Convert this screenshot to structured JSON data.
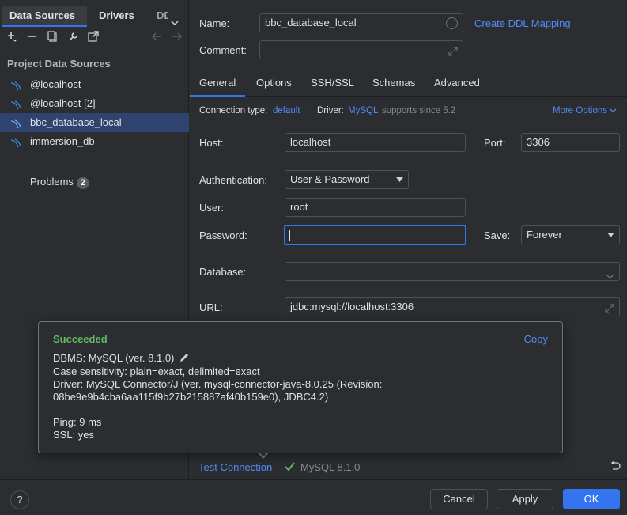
{
  "left": {
    "tabs": [
      "Data Sources",
      "Drivers",
      "DDL"
    ],
    "section_title": "Project Data Sources",
    "items": [
      {
        "label": "@localhost"
      },
      {
        "label": "@localhost [2]"
      },
      {
        "label": "bbc_database_local"
      },
      {
        "label": "immersion_db"
      }
    ],
    "problems_label": "Problems",
    "problems_count": "2"
  },
  "right": {
    "name_label": "Name:",
    "name_value": "bbc_database_local",
    "create_ddl": "Create DDL Mapping",
    "comment_label": "Comment:",
    "comment_value": "",
    "tabs": [
      "General",
      "Options",
      "SSH/SSL",
      "Schemas",
      "Advanced"
    ],
    "conn_type_label": "Connection type:",
    "conn_type_value": "default",
    "driver_label": "Driver:",
    "driver_value": "MySQL",
    "driver_note": "supports since 5.2",
    "more_options": "More Options",
    "host_label": "Host:",
    "host_value": "localhost",
    "port_label": "Port:",
    "port_value": "3306",
    "auth_label": "Authentication:",
    "auth_value": "User & Password",
    "user_label": "User:",
    "user_value": "root",
    "password_label": "Password:",
    "password_value": "",
    "save_label": "Save:",
    "save_value": "Forever",
    "database_label": "Database:",
    "database_value": "",
    "url_label": "URL:",
    "url_value": "jdbc:mysql://localhost:3306"
  },
  "popup": {
    "title": "Succeeded",
    "copy": "Copy",
    "dbms": "DBMS: MySQL (ver. 8.1.0)",
    "case": "Case sensitivity: plain=exact, delimited=exact",
    "driver1": "Driver: MySQL Connector/J (ver. mysql-connector-java-8.0.25 (Revision:",
    "driver2": "08be9e9b4cba6aa115f9b27b215887af40b159e0), JDBC4.2)",
    "ping": "Ping: 9 ms",
    "ssl": "SSL: yes"
  },
  "testbar": {
    "test_connection": "Test Connection",
    "status": "MySQL 8.1.0"
  },
  "bottom": {
    "help": "?",
    "cancel": "Cancel",
    "apply": "Apply",
    "ok": "OK"
  },
  "colors": {
    "accent": "#3574f0",
    "link": "#548af7",
    "success": "#5fb865",
    "background": "#2b2d30"
  }
}
